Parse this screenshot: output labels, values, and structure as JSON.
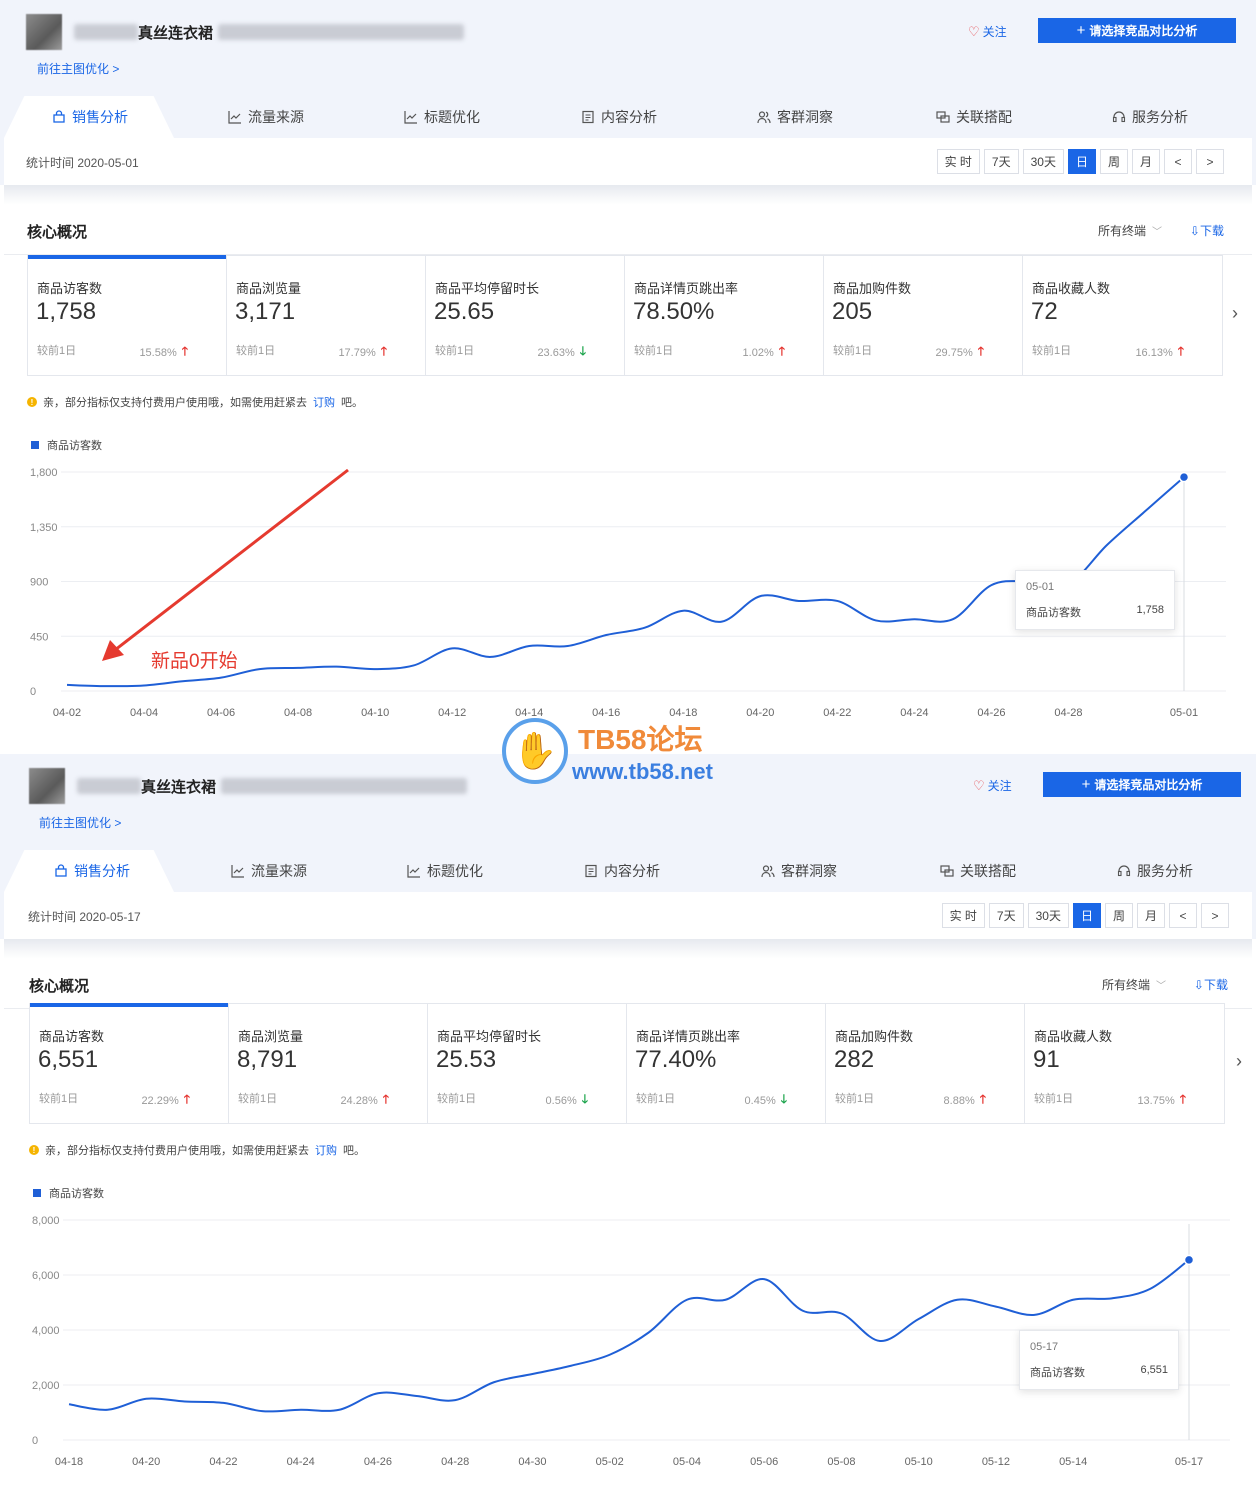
{
  "panels": [
    {
      "product_title": "真丝连衣裙",
      "main_image_link": "前往主图优化 >",
      "follow_label": "关注",
      "compare_button": "请选择竞品对比分析",
      "tabs": [
        {
          "label": "销售分析",
          "icon": "bag-icon"
        },
        {
          "label": "流量来源",
          "icon": "line-chart-icon"
        },
        {
          "label": "标题优化",
          "icon": "line-chart-icon"
        },
        {
          "label": "内容分析",
          "icon": "document-icon"
        },
        {
          "label": "客群洞察",
          "icon": "users-icon"
        },
        {
          "label": "关联搭配",
          "icon": "link-icon"
        },
        {
          "label": "服务分析",
          "icon": "headset-icon"
        }
      ],
      "stat_time": "统计时间 2020-05-01",
      "periods": [
        "实 时",
        "7天",
        "30天",
        "日",
        "周",
        "月",
        "<",
        ">"
      ],
      "active_period": "日",
      "core_title": "核心概况",
      "terminal_select": "所有终端",
      "download": "下载",
      "metrics": [
        {
          "label": "商品访客数",
          "value": "1,758",
          "cmp": "较前1日",
          "pct": "15.58%",
          "dir": "up"
        },
        {
          "label": "商品浏览量",
          "value": "3,171",
          "cmp": "较前1日",
          "pct": "17.79%",
          "dir": "up"
        },
        {
          "label": "商品平均停留时长",
          "value": "25.65",
          "cmp": "较前1日",
          "pct": "23.63%",
          "dir": "down"
        },
        {
          "label": "商品详情页跳出率",
          "value": "78.50%",
          "cmp": "较前1日",
          "pct": "1.02%",
          "dir": "up"
        },
        {
          "label": "商品加购件数",
          "value": "205",
          "cmp": "较前1日",
          "pct": "29.75%",
          "dir": "up"
        },
        {
          "label": "商品收藏人数",
          "value": "72",
          "cmp": "较前1日",
          "pct": "16.13%",
          "dir": "up"
        }
      ],
      "notice": {
        "text": "亲，部分指标仅支持付费用户使用哦，如需使用赶紧去",
        "link": "订购",
        "tail": "吧。"
      },
      "annotation": "新品0开始",
      "tooltip": {
        "date": "05-01",
        "name": "商品访客数",
        "value": "1,758"
      }
    },
    {
      "product_title": "真丝连衣裙",
      "main_image_link": "前往主图优化 >",
      "follow_label": "关注",
      "compare_button": "请选择竞品对比分析",
      "tabs": [
        {
          "label": "销售分析",
          "icon": "bag-icon"
        },
        {
          "label": "流量来源",
          "icon": "line-chart-icon"
        },
        {
          "label": "标题优化",
          "icon": "line-chart-icon"
        },
        {
          "label": "内容分析",
          "icon": "document-icon"
        },
        {
          "label": "客群洞察",
          "icon": "users-icon"
        },
        {
          "label": "关联搭配",
          "icon": "link-icon"
        },
        {
          "label": "服务分析",
          "icon": "headset-icon"
        }
      ],
      "stat_time": "统计时间 2020-05-17",
      "periods": [
        "实 时",
        "7天",
        "30天",
        "日",
        "周",
        "月",
        "<",
        ">"
      ],
      "active_period": "日",
      "core_title": "核心概况",
      "terminal_select": "所有终端",
      "download": "下载",
      "metrics": [
        {
          "label": "商品访客数",
          "value": "6,551",
          "cmp": "较前1日",
          "pct": "22.29%",
          "dir": "up"
        },
        {
          "label": "商品浏览量",
          "value": "8,791",
          "cmp": "较前1日",
          "pct": "24.28%",
          "dir": "up"
        },
        {
          "label": "商品平均停留时长",
          "value": "25.53",
          "cmp": "较前1日",
          "pct": "0.56%",
          "dir": "down"
        },
        {
          "label": "商品详情页跳出率",
          "value": "77.40%",
          "cmp": "较前1日",
          "pct": "0.45%",
          "dir": "down"
        },
        {
          "label": "商品加购件数",
          "value": "282",
          "cmp": "较前1日",
          "pct": "8.88%",
          "dir": "up"
        },
        {
          "label": "商品收藏人数",
          "value": "91",
          "cmp": "较前1日",
          "pct": "13.75%",
          "dir": "up"
        }
      ],
      "notice": {
        "text": "亲，部分指标仅支持付费用户使用哦，如需使用赶紧去",
        "link": "订购",
        "tail": "吧。"
      },
      "tooltip": {
        "date": "05-17",
        "name": "商品访客数",
        "value": "6,551"
      }
    }
  ],
  "watermark": {
    "title": "TB58论坛",
    "url": "www.tb58.net"
  },
  "chart_data": [
    {
      "type": "line",
      "legend": "商品访客数",
      "color": "#1f5fd6",
      "ylim": [
        0,
        1800
      ],
      "yticks": [
        "0",
        "450",
        "900",
        "1,350",
        "1,800"
      ],
      "xtick_labels": [
        "04-02",
        "04-04",
        "04-06",
        "04-08",
        "04-10",
        "04-12",
        "04-14",
        "04-16",
        "04-18",
        "04-20",
        "04-22",
        "04-24",
        "04-26",
        "04-28",
        "05-01"
      ],
      "x": [
        "04-02",
        "04-03",
        "04-04",
        "04-05",
        "04-06",
        "04-07",
        "04-08",
        "04-09",
        "04-10",
        "04-11",
        "04-12",
        "04-13",
        "04-14",
        "04-15",
        "04-16",
        "04-17",
        "04-18",
        "04-19",
        "04-20",
        "04-21",
        "04-22",
        "04-23",
        "04-24",
        "04-25",
        "04-26",
        "04-27",
        "04-28",
        "04-29",
        "04-30",
        "05-01"
      ],
      "series": [
        {
          "name": "商品访客数",
          "values": [
            50,
            40,
            45,
            80,
            110,
            180,
            190,
            200,
            180,
            210,
            350,
            280,
            370,
            370,
            460,
            520,
            660,
            570,
            780,
            740,
            740,
            580,
            590,
            590,
            870,
            900,
            880,
            1200,
            1480,
            1758
          ]
        }
      ]
    },
    {
      "type": "line",
      "legend": "商品访客数",
      "color": "#1f5fd6",
      "ylim": [
        0,
        8000
      ],
      "yticks": [
        "0",
        "2,000",
        "4,000",
        "6,000",
        "8,000"
      ],
      "xtick_labels": [
        "04-18",
        "04-20",
        "04-22",
        "04-24",
        "04-26",
        "04-28",
        "04-30",
        "05-02",
        "05-04",
        "05-06",
        "05-08",
        "05-10",
        "05-12",
        "05-14",
        "05-17"
      ],
      "x": [
        "04-18",
        "04-19",
        "04-20",
        "04-21",
        "04-22",
        "04-23",
        "04-24",
        "04-25",
        "04-26",
        "04-27",
        "04-28",
        "04-29",
        "04-30",
        "05-01",
        "05-02",
        "05-03",
        "05-04",
        "05-05",
        "05-06",
        "05-07",
        "05-08",
        "05-09",
        "05-10",
        "05-11",
        "05-12",
        "05-13",
        "05-14",
        "05-15",
        "05-16",
        "05-17"
      ],
      "series": [
        {
          "name": "商品访客数",
          "values": [
            1300,
            1100,
            1500,
            1400,
            1350,
            1050,
            1100,
            1100,
            1700,
            1600,
            1450,
            2100,
            2400,
            2700,
            3100,
            3900,
            5100,
            5100,
            5850,
            4700,
            4600,
            3600,
            4400,
            5100,
            4850,
            4550,
            5100,
            5150,
            5500,
            6551
          ]
        }
      ]
    }
  ]
}
